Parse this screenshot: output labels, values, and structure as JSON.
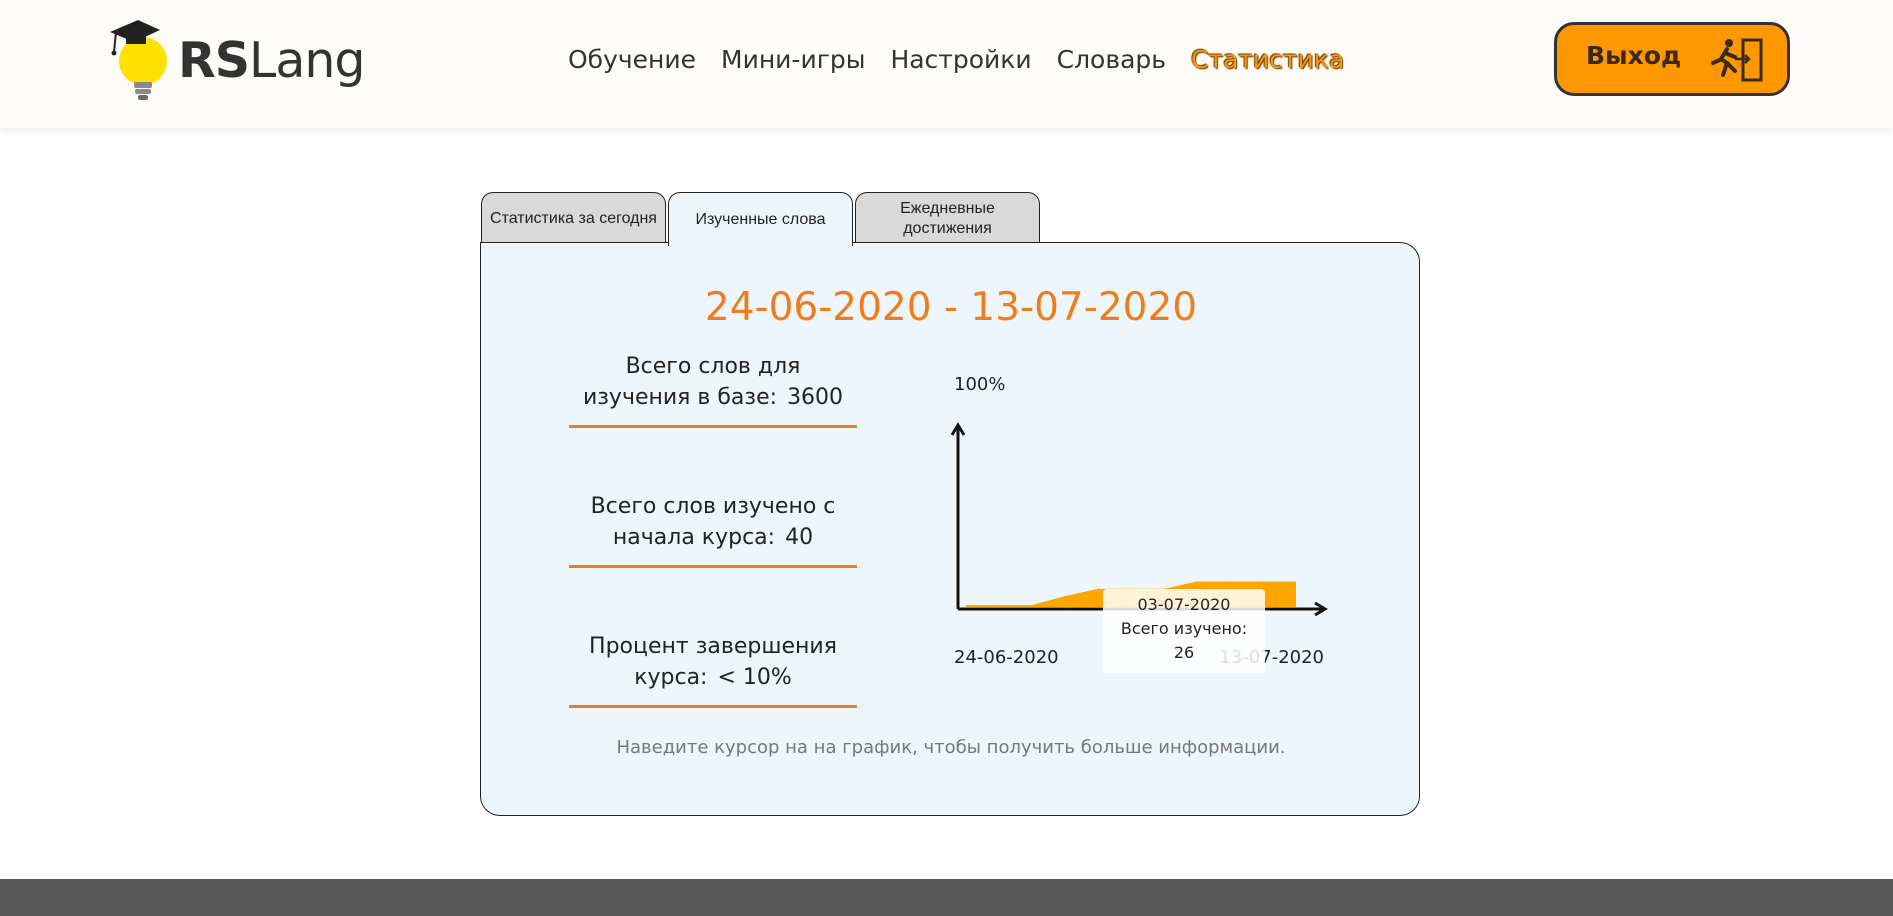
{
  "header": {
    "logo": {
      "strong": "RS",
      "light": "Lang"
    },
    "nav": [
      {
        "label": "Обучение",
        "active": false
      },
      {
        "label": "Мини-игры",
        "active": false
      },
      {
        "label": "Настройки",
        "active": false
      },
      {
        "label": "Словарь",
        "active": false
      },
      {
        "label": "Статистика",
        "active": true
      }
    ],
    "logout_label": "Выход"
  },
  "tabs": [
    {
      "label": "Статистика за сегодня",
      "active": false
    },
    {
      "label": "Изученные слова",
      "active": true
    },
    {
      "label": "Ежедневные достижения",
      "active": false
    }
  ],
  "panel": {
    "range_title": "24-06-2020 - 13-07-2020",
    "stats": [
      {
        "label": "Всего слов для изучения в базе:",
        "value": "3600"
      },
      {
        "label": "Всего слов изучено с начала курса:",
        "value": "40"
      },
      {
        "label": "Процент завершения курса:",
        "value": "< 10%"
      }
    ],
    "hint": "Наведите курсор на на график, чтобы получить больше информации."
  },
  "chart_data": {
    "type": "area",
    "y_top_label": "100%",
    "x_start_label": "24-06-2020",
    "x_end_label": "13-07-2020",
    "ylim": [
      0,
      100
    ],
    "x": [
      "24-06-2020",
      "26-06-2020",
      "28-06-2020",
      "30-06-2020",
      "01-07-2020",
      "03-07-2020",
      "05-07-2020",
      "07-07-2020",
      "09-07-2020",
      "11-07-2020",
      "13-07-2020"
    ],
    "values": [
      1,
      1,
      1,
      6,
      10,
      10,
      10,
      14,
      14,
      14,
      14
    ],
    "color": "#ffa500",
    "tooltip": {
      "date": "03-07-2020",
      "label": "Всего изучено:",
      "value": "26"
    }
  },
  "colors": {
    "accent": "#ff9800",
    "title": "#f07d1d",
    "panel_bg": "#eef6fd",
    "footer": "#575757"
  }
}
